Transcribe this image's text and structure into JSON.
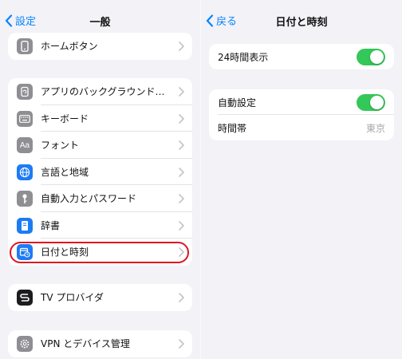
{
  "left": {
    "nav": {
      "back_label": "設定",
      "title": "一般"
    },
    "groups": [
      {
        "items": [
          {
            "label": "ホームボタン",
            "icon": "home-button-icon"
          }
        ]
      },
      {
        "items": [
          {
            "label": "アプリのバックグラウンド…",
            "icon": "background-refresh-icon"
          },
          {
            "label": "キーボード",
            "icon": "keyboard-icon"
          },
          {
            "label": "フォント",
            "icon": "font-icon",
            "glyph": "Aa"
          },
          {
            "label": "言語と地域",
            "icon": "globe-icon"
          },
          {
            "label": "自動入力とパスワード",
            "icon": "key-icon"
          },
          {
            "label": "辞書",
            "icon": "dictionary-icon"
          },
          {
            "label": "日付と時刻",
            "icon": "calendar-clock-icon",
            "highlighted": true
          }
        ]
      },
      {
        "items": [
          {
            "label": "TV プロバイダ",
            "icon": "tv-provider-icon"
          }
        ]
      },
      {
        "items": [
          {
            "label": "VPN とデバイス管理",
            "icon": "gear-icon"
          }
        ]
      }
    ]
  },
  "right": {
    "nav": {
      "back_label": "戻る",
      "title": "日付と時刻"
    },
    "groups": [
      {
        "items": [
          {
            "label": "24時間表示",
            "control": "toggle",
            "on": true
          }
        ]
      },
      {
        "items": [
          {
            "label": "自動設定",
            "control": "toggle",
            "on": true
          },
          {
            "label": "時間帯",
            "value": "東京"
          }
        ]
      }
    ]
  },
  "colors": {
    "accent": "#0a84ff",
    "toggle_on": "#34c759",
    "highlight_ring": "#e0141e",
    "background": "#f2f2f7"
  }
}
